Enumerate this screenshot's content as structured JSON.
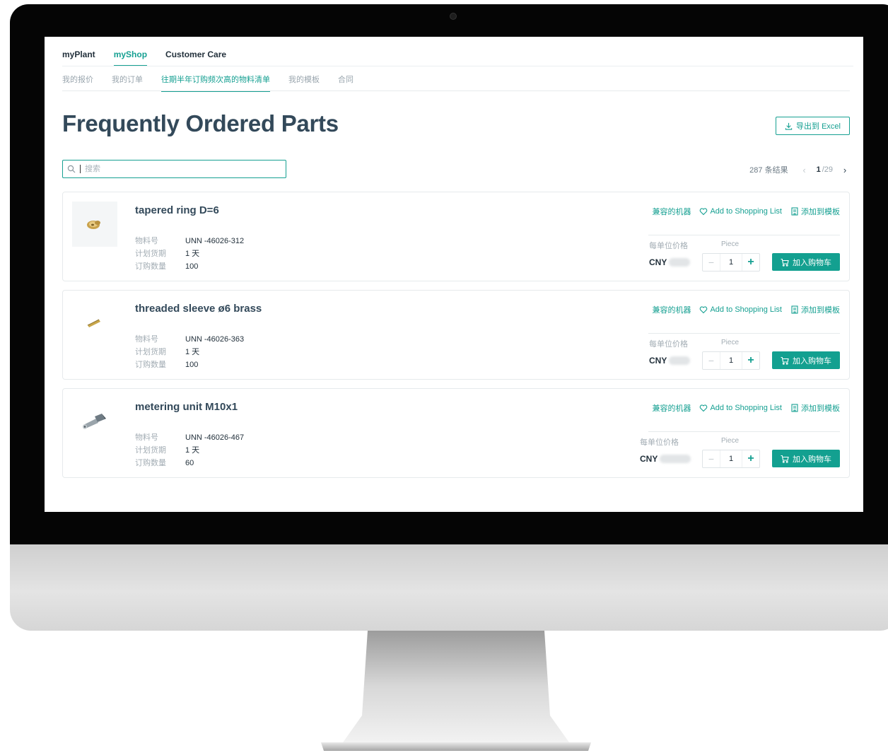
{
  "topnav": [
    "myPlant",
    "myShop",
    "Customer Care"
  ],
  "subnav": [
    "我的报价",
    "我的订单",
    "往期半年订购频次高的物料清单",
    "我的模板",
    "合同"
  ],
  "page_title": "Frequently Ordered Parts",
  "export_label": "导出到 Excel",
  "search": {
    "placeholder": "搜索"
  },
  "pager": {
    "results": "287 条结果",
    "current": "1",
    "total": "/29"
  },
  "labels": {
    "part_no": "物料号",
    "lead_time": "计划货期",
    "order_qty": "订购数量",
    "compatible": "兼容的机器",
    "shopping_list": "Add to Shopping List",
    "add_template": "添加到模板",
    "unit_price": "每单位价格",
    "piece": "Piece",
    "currency": "CNY",
    "add_to_cart": "加入购物车"
  },
  "items": [
    {
      "name": "tapered ring D=6",
      "part_no": "UNN -46026-312",
      "lead_time": "1 天",
      "order_qty": "100",
      "qty": "1"
    },
    {
      "name": "threaded sleeve ø6 brass",
      "part_no": "UNN -46026-363",
      "lead_time": "1 天",
      "order_qty": "100",
      "qty": "1"
    },
    {
      "name": "metering unit M10x1",
      "part_no": "UNN -46026-467",
      "lead_time": "1 天",
      "order_qty": "60",
      "qty": "1"
    }
  ],
  "colors": {
    "accent": "#16a092",
    "title": "#33495a"
  }
}
